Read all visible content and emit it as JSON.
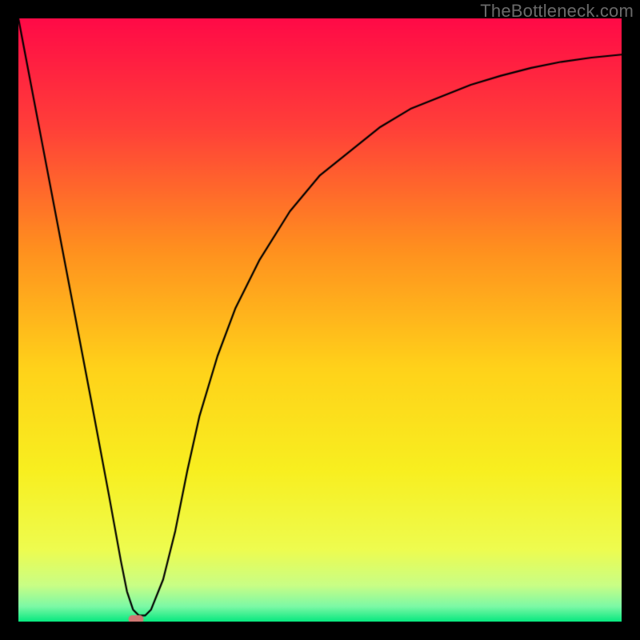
{
  "watermark": "TheBottleneck.com",
  "chart_data": {
    "type": "line",
    "title": "",
    "xlabel": "",
    "ylabel": "",
    "xlim": [
      0,
      100
    ],
    "ylim": [
      0,
      100
    ],
    "series": [
      {
        "name": "curve",
        "x": [
          0,
          4,
          8,
          12,
          15,
          17,
          18,
          19,
          20,
          21,
          22,
          24,
          26,
          28,
          30,
          33,
          36,
          40,
          45,
          50,
          55,
          60,
          65,
          70,
          75,
          80,
          85,
          90,
          95,
          100
        ],
        "y": [
          100,
          79,
          58,
          37,
          21,
          10,
          5,
          2,
          1,
          1,
          2,
          7,
          15,
          25,
          34,
          44,
          52,
          60,
          68,
          74,
          78,
          82,
          85,
          87,
          89,
          90.5,
          91.8,
          92.8,
          93.5,
          94
        ]
      }
    ],
    "marker": {
      "x": 19.5,
      "y": 0.4
    },
    "background": {
      "type": "vertical-gradient",
      "stops": [
        {
          "pos": 0.0,
          "color": "#ff0a47"
        },
        {
          "pos": 0.18,
          "color": "#ff3f39"
        },
        {
          "pos": 0.38,
          "color": "#ff8f1f"
        },
        {
          "pos": 0.58,
          "color": "#ffd21a"
        },
        {
          "pos": 0.75,
          "color": "#f8ef20"
        },
        {
          "pos": 0.88,
          "color": "#eefc4f"
        },
        {
          "pos": 0.94,
          "color": "#c9fe86"
        },
        {
          "pos": 0.975,
          "color": "#7cf9a6"
        },
        {
          "pos": 1.0,
          "color": "#07e87f"
        }
      ]
    },
    "frame_color": "#000000"
  }
}
